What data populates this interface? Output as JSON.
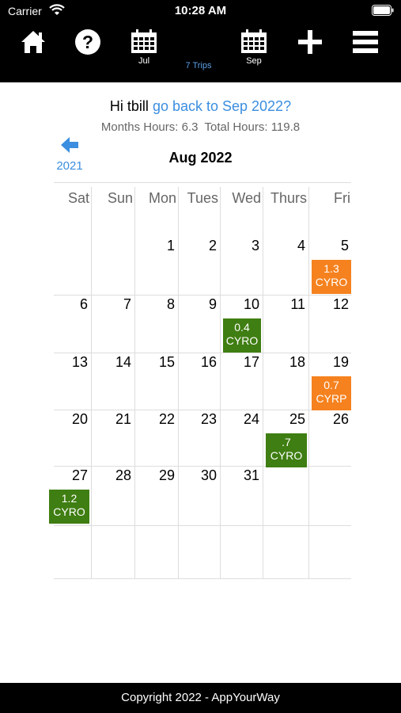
{
  "status": {
    "carrier": "Carrier",
    "time": "10:28 AM"
  },
  "nav": {
    "prev_month_label": "Jul",
    "trips_label": "7 Trips",
    "next_month_label": "Sep"
  },
  "header": {
    "greeting": "Hi tbill",
    "link_text": "go back to Sep 2022?",
    "hours_text": "Months Hours: 6.3  Total Hours: 119.8"
  },
  "back": {
    "year_label": "2021"
  },
  "month_title": "Aug 2022",
  "weekdays": [
    "Sat",
    "Sun",
    "Mon",
    "Tues",
    "Wed",
    "Thurs",
    "Fri"
  ],
  "days": [
    "1",
    "2",
    "3",
    "4",
    "5",
    "6",
    "7",
    "8",
    "9",
    "10",
    "11",
    "12",
    "13",
    "14",
    "15",
    "16",
    "17",
    "18",
    "19",
    "20",
    "21",
    "22",
    "23",
    "24",
    "25",
    "26",
    "27",
    "28",
    "29",
    "30",
    "31"
  ],
  "events": [
    {
      "hours": "1.3",
      "code": "CYRO",
      "color": "#f5821f"
    },
    {
      "hours": "0.4",
      "code": "CYRO",
      "color": "#3f7e12"
    },
    {
      "hours": "0.7",
      "code": "CYRP",
      "color": "#f5821f"
    },
    {
      "hours": ".7",
      "code": "CYRO",
      "color": "#3f7e12"
    },
    {
      "hours": "1.2",
      "code": "CYRO",
      "color": "#3f7e12"
    }
  ],
  "footer": "Copyright 2022 - AppYourWay",
  "colors": {
    "link": "#3b8ee0",
    "orange": "#f5821f",
    "green": "#3f7e12"
  },
  "icons": [
    "home-icon",
    "help-icon",
    "calendar-icon",
    "plus-icon",
    "menu-icon",
    "back-arrow-icon"
  ]
}
